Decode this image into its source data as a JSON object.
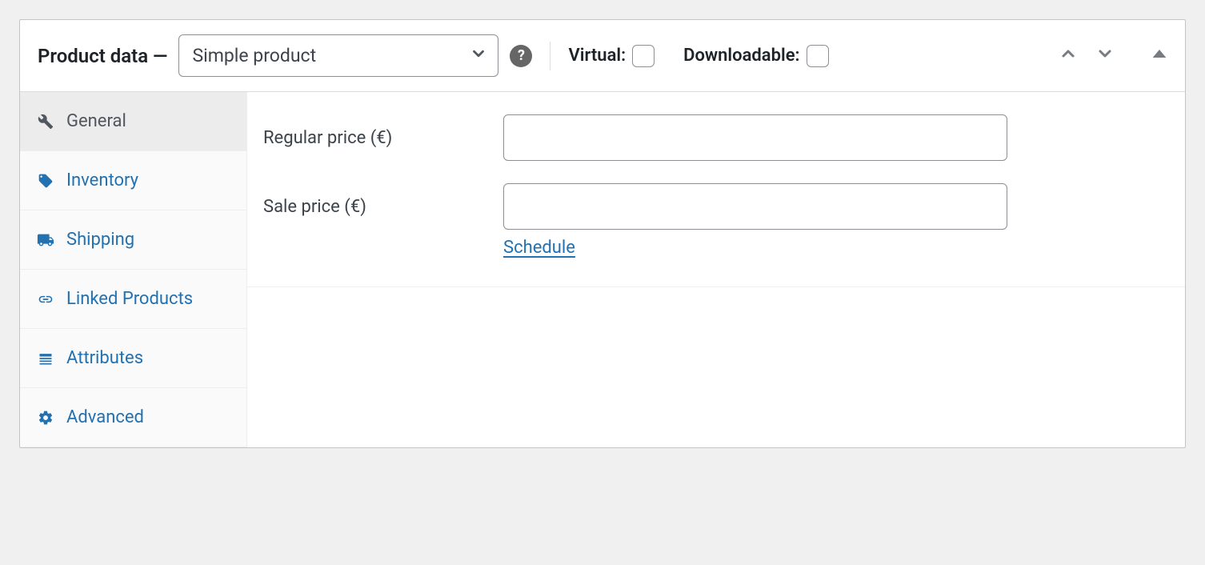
{
  "header": {
    "title": "Product data —",
    "product_type": "Simple product",
    "virtual_label": "Virtual:",
    "downloadable_label": "Downloadable:"
  },
  "sidebar": {
    "items": [
      {
        "label": "General"
      },
      {
        "label": "Inventory"
      },
      {
        "label": "Shipping"
      },
      {
        "label": "Linked Products"
      },
      {
        "label": "Attributes"
      },
      {
        "label": "Advanced"
      }
    ]
  },
  "general": {
    "regular_price_label": "Regular price (€)",
    "regular_price_value": "",
    "sale_price_label": "Sale price (€)",
    "sale_price_value": "",
    "schedule_label": "Schedule"
  }
}
